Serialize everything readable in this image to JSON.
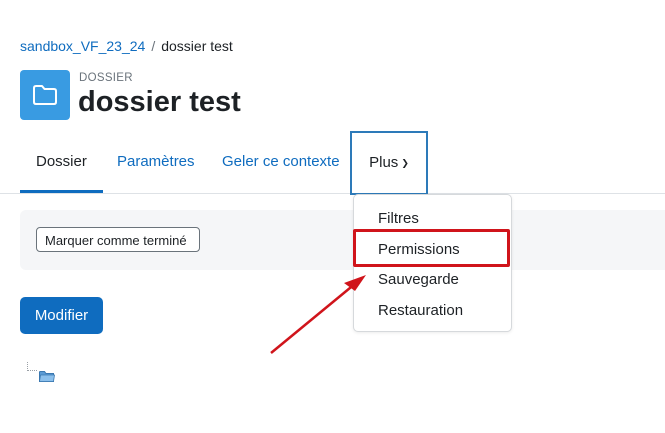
{
  "breadcrumb": {
    "course": "sandbox_VF_23_24",
    "separator": "/",
    "current": "dossier test"
  },
  "header": {
    "icon": "folder-icon",
    "subtitle": "DOSSIER",
    "title": "dossier test",
    "icon_color": "#399be2"
  },
  "tabs": [
    {
      "label": "Dossier",
      "active": true
    },
    {
      "label": "Paramètres",
      "active": false
    },
    {
      "label": "Geler ce contexte",
      "active": false
    },
    {
      "label": "Plus",
      "active": false
    }
  ],
  "completion": {
    "mark_done_label": "Marquer comme terminé"
  },
  "actions": {
    "modify_label": "Modifier"
  },
  "dropdown": {
    "items": [
      {
        "label": "Filtres"
      },
      {
        "label": "Permissions"
      },
      {
        "label": "Sauvegarde"
      },
      {
        "label": "Restauration"
      }
    ],
    "highlighted": "Permissions"
  },
  "colors": {
    "link": "#0f6cbf",
    "primary_button": "#0f6cbf",
    "annotation": "#d0141b",
    "focus_outline": "#2d7ab9"
  }
}
